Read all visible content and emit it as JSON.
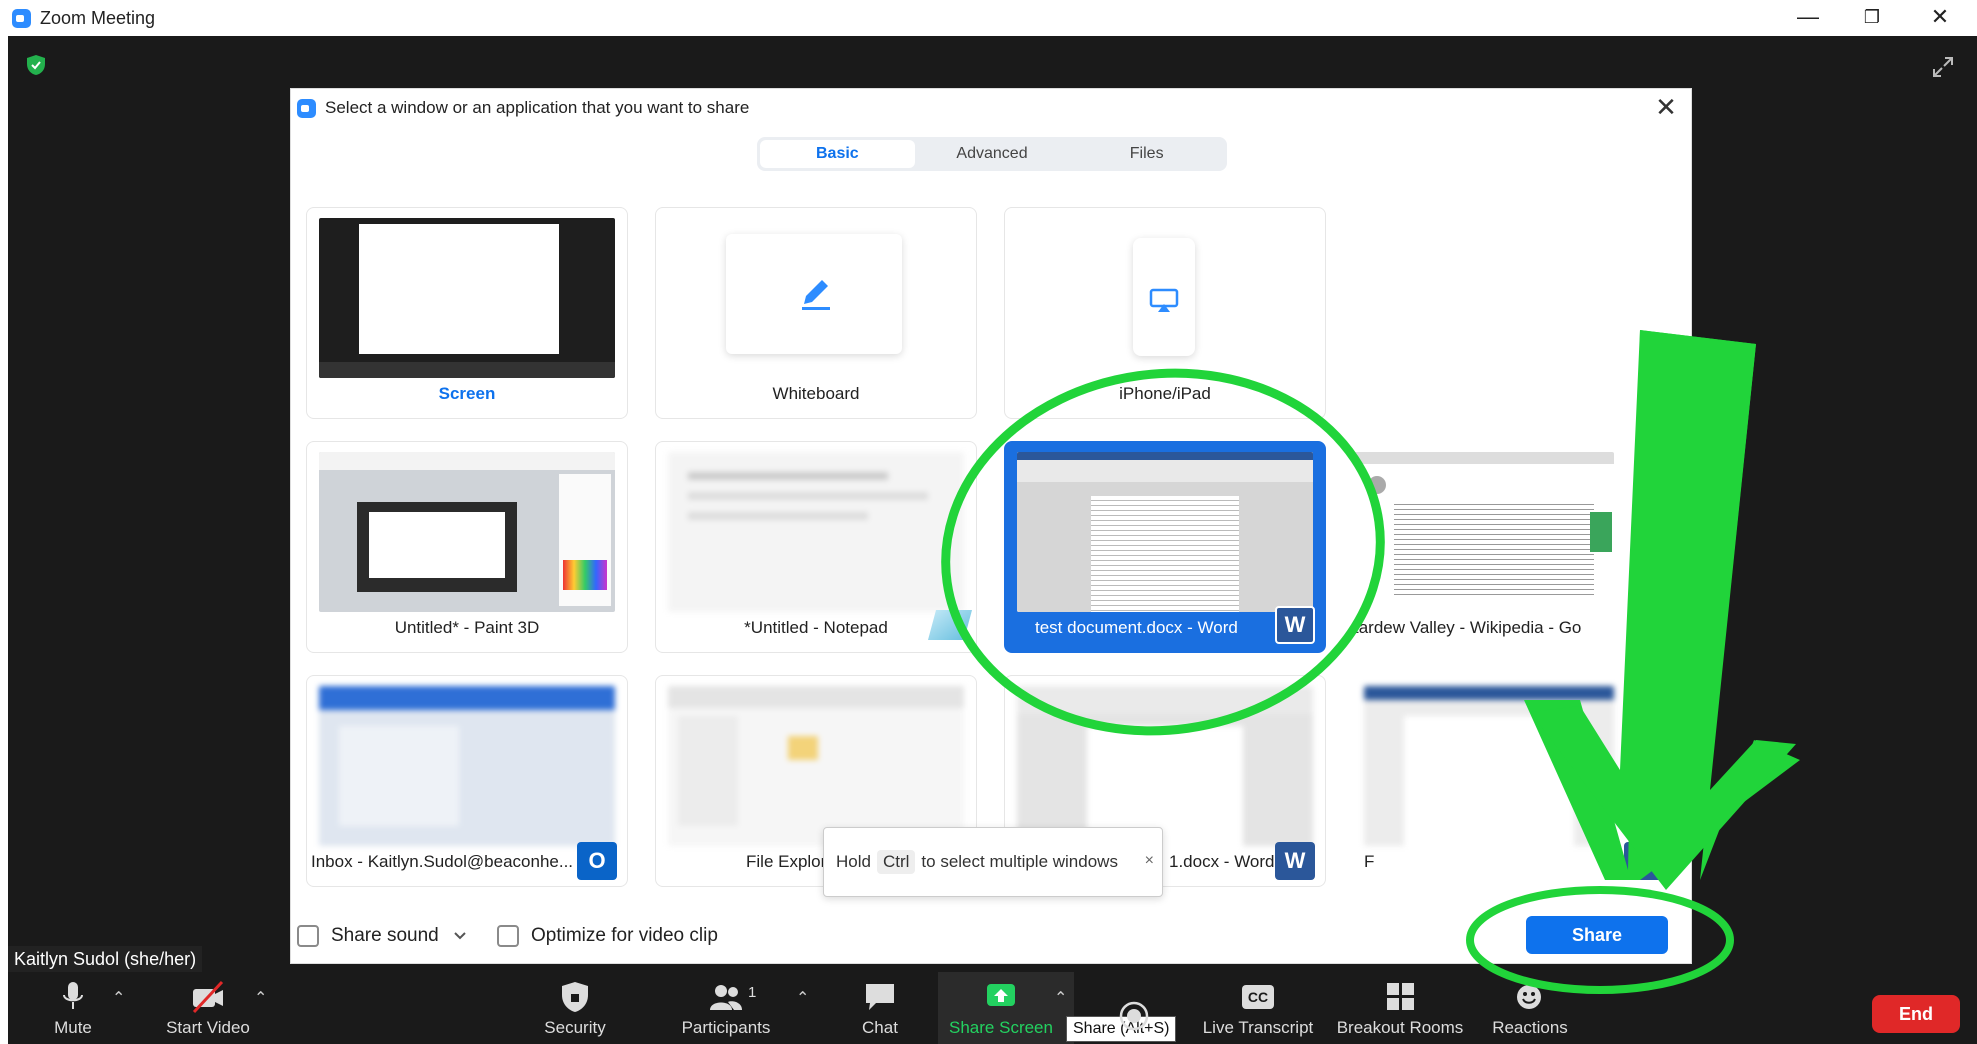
{
  "window": {
    "title": "Zoom Meeting",
    "minimize": "—",
    "restore": "❐",
    "close": "✕"
  },
  "meeting": {
    "participant_name": "Kaitlyn Sudol (she/her)"
  },
  "dialog": {
    "title": "Select a window or an application that you want to share",
    "close": "✕",
    "tabs": [
      {
        "label": "Basic",
        "active": true
      },
      {
        "label": "Advanced",
        "active": false
      },
      {
        "label": "Files",
        "active": false
      }
    ],
    "tiles": [
      {
        "label": "Screen"
      },
      {
        "label": "Whiteboard"
      },
      {
        "label": "iPhone/iPad"
      },
      {
        "label": "Untitled* - Paint 3D"
      },
      {
        "label": "*Untitled - Notepad"
      },
      {
        "label": "test document.docx - Word",
        "selected": true
      },
      {
        "label": "tardew Valley - Wikipedia - Go"
      },
      {
        "label": "Inbox - Kaitlyn.Sudol@beaconhe..."
      },
      {
        "label": "File Explor"
      },
      {
        "label": "1.docx - Word"
      },
      {
        "label": "F"
      }
    ],
    "hint": {
      "prefix": "Hold",
      "key": "Ctrl",
      "suffix": "to select multiple windows",
      "close": "×"
    },
    "share_sound_label": "Share sound",
    "optimize_label": "Optimize for video clip",
    "share_button": "Share"
  },
  "toolbar": {
    "mute": "Mute",
    "start_video": "Start Video",
    "security": "Security",
    "participants": "Participants",
    "participants_count": "1",
    "chat": "Chat",
    "share_screen": "Share Screen",
    "share_tooltip": "Share (Alt+S)",
    "record": "",
    "live_transcript": "Live Transcript",
    "cc": "CC",
    "breakout_rooms": "Breakout Rooms",
    "reactions": "Reactions",
    "end": "End"
  },
  "colors": {
    "accent": "#0e72ed",
    "selected_tile": "#1a6fe0",
    "annotation_green": "#21d43a",
    "end_red": "#e02828",
    "shield_green": "#23b14d"
  }
}
